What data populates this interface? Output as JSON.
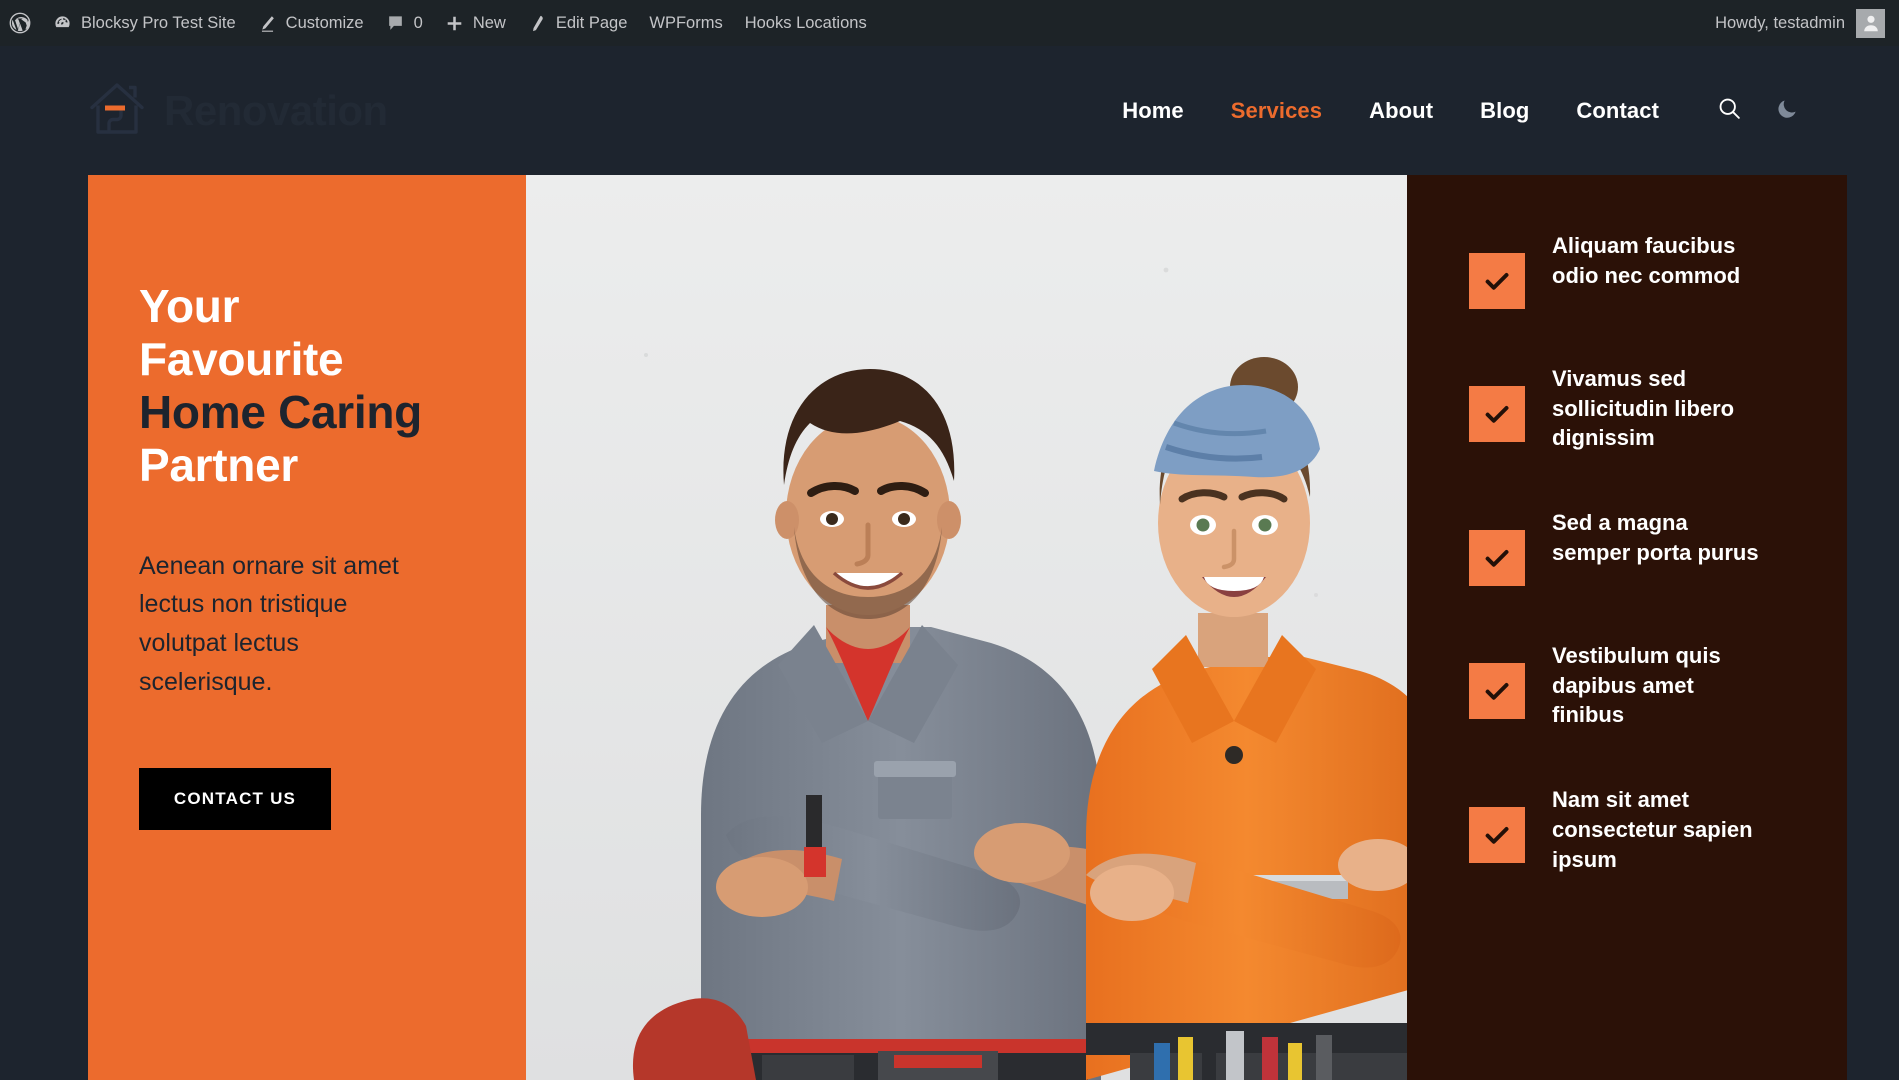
{
  "adminbar": {
    "items": [
      {
        "icon": "wordpress-logo-icon",
        "label": ""
      },
      {
        "icon": "dashboard-icon",
        "label": "Blocksy Pro Test Site"
      },
      {
        "icon": "customize-brush-icon",
        "label": "Customize"
      },
      {
        "icon": "comment-bubble-icon",
        "label": "0"
      },
      {
        "icon": "plus-icon",
        "label": "New"
      },
      {
        "icon": "pencil-icon",
        "label": "Edit Page"
      },
      {
        "icon": "none",
        "label": "WPForms"
      },
      {
        "icon": "none",
        "label": "Hooks Locations"
      }
    ],
    "howdy": "Howdy, testadmin",
    "avatar_icon": "user-avatar-icon"
  },
  "header": {
    "logo_icon": "house-logo-icon",
    "logo_text": "Renovation",
    "nav": [
      {
        "label": "Home",
        "active": false
      },
      {
        "label": "Services",
        "active": true
      },
      {
        "label": "About",
        "active": false
      },
      {
        "label": "Blog",
        "active": false
      },
      {
        "label": "Contact",
        "active": false
      }
    ],
    "search_icon": "search-icon",
    "darkmode_icon": "moon-icon"
  },
  "hero": {
    "title_line1": "Your",
    "title_line2": "Favourite",
    "title_line3": "Home Caring",
    "title_line4": "Partner",
    "paragraph": "Aenean ornare sit amet lectus non tristique volutpat lectus scelerisque.",
    "cta_label": "CONTACT US",
    "image_alt": "Two smiling renovation workers with tool belts standing with arms crossed",
    "features": [
      {
        "icon": "check-icon",
        "text": "Aliquam faucibus odio nec commod"
      },
      {
        "icon": "check-icon",
        "text": "Vivamus sed sollicitudin libero dignissim"
      },
      {
        "icon": "check-icon",
        "text": "Sed a magna semper porta purus"
      },
      {
        "icon": "check-icon",
        "text": "Vestibulum quis dapibus amet finibus"
      },
      {
        "icon": "check-icon",
        "text": "Nam sit amet consectetur sapien ipsum"
      }
    ]
  },
  "colors": {
    "accent_orange": "#ec6b2d",
    "checkbox_orange": "#f47b45",
    "dark_navy": "#1d242e",
    "dark_brown": "#2b1107",
    "adminbar_bg": "#1d2327"
  }
}
